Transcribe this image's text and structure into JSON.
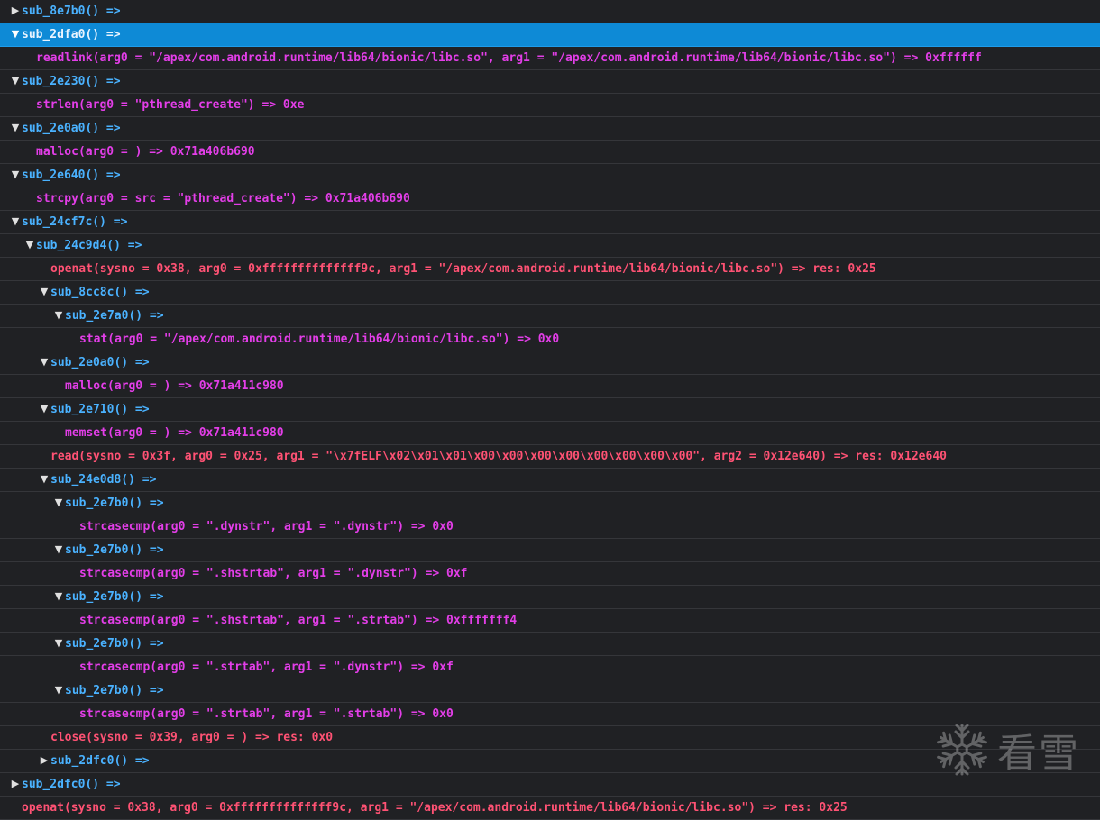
{
  "colors": {
    "background": "#202124",
    "selected_row": "#0e8ad6",
    "function_name": "#4ab2ff",
    "libc_call": "#e33ee8",
    "syscall": "#ff5274"
  },
  "rows": [
    {
      "depth": 0,
      "kind": "node",
      "expanded": false,
      "text": "sub_8e7b0() =>"
    },
    {
      "depth": 0,
      "kind": "node",
      "expanded": true,
      "selected": true,
      "text": "sub_2dfa0() =>"
    },
    {
      "depth": 1,
      "kind": "libc",
      "text": "readlink(arg0 = \"/apex/com.android.runtime/lib64/bionic/libc.so\", arg1 = \"/apex/com.android.runtime/lib64/bionic/libc.so\") => 0xffffff"
    },
    {
      "depth": 0,
      "kind": "node",
      "expanded": true,
      "text": "sub_2e230() =>"
    },
    {
      "depth": 1,
      "kind": "libc",
      "text": "strlen(arg0 = \"pthread_create\") => 0xe"
    },
    {
      "depth": 0,
      "kind": "node",
      "expanded": true,
      "text": "sub_2e0a0() =>"
    },
    {
      "depth": 1,
      "kind": "libc",
      "text": "malloc(arg0 = ) => 0x71a406b690"
    },
    {
      "depth": 0,
      "kind": "node",
      "expanded": true,
      "text": "sub_2e640() =>"
    },
    {
      "depth": 1,
      "kind": "libc",
      "text": "strcpy(arg0 = src = \"pthread_create\") => 0x71a406b690"
    },
    {
      "depth": 0,
      "kind": "node",
      "expanded": true,
      "text": "sub_24cf7c() =>"
    },
    {
      "depth": 1,
      "kind": "node",
      "expanded": true,
      "text": "sub_24c9d4() =>"
    },
    {
      "depth": 2,
      "kind": "sys",
      "text": "openat(sysno = 0x38, arg0 = 0xffffffffffffff9c, arg1 = \"/apex/com.android.runtime/lib64/bionic/libc.so\") => res: 0x25"
    },
    {
      "depth": 2,
      "kind": "node",
      "expanded": true,
      "text": "sub_8cc8c() =>"
    },
    {
      "depth": 3,
      "kind": "node",
      "expanded": true,
      "text": "sub_2e7a0() =>"
    },
    {
      "depth": 4,
      "kind": "libc",
      "text": "stat(arg0 = \"/apex/com.android.runtime/lib64/bionic/libc.so\") => 0x0"
    },
    {
      "depth": 2,
      "kind": "node",
      "expanded": true,
      "text": "sub_2e0a0() =>"
    },
    {
      "depth": 3,
      "kind": "libc",
      "text": "malloc(arg0 = ) => 0x71a411c980"
    },
    {
      "depth": 2,
      "kind": "node",
      "expanded": true,
      "text": "sub_2e710() =>"
    },
    {
      "depth": 3,
      "kind": "libc",
      "text": "memset(arg0 = ) => 0x71a411c980"
    },
    {
      "depth": 2,
      "kind": "sys",
      "text": "read(sysno = 0x3f, arg0 = 0x25, arg1 = \"\\x7fELF\\x02\\x01\\x01\\x00\\x00\\x00\\x00\\x00\\x00\\x00\\x00\", arg2 = 0x12e640) => res: 0x12e640"
    },
    {
      "depth": 2,
      "kind": "node",
      "expanded": true,
      "text": "sub_24e0d8() =>"
    },
    {
      "depth": 3,
      "kind": "node",
      "expanded": true,
      "text": "sub_2e7b0() =>"
    },
    {
      "depth": 4,
      "kind": "libc",
      "text": "strcasecmp(arg0 = \".dynstr\", arg1 = \".dynstr\") => 0x0"
    },
    {
      "depth": 3,
      "kind": "node",
      "expanded": true,
      "text": "sub_2e7b0() =>"
    },
    {
      "depth": 4,
      "kind": "libc",
      "text": "strcasecmp(arg0 = \".shstrtab\", arg1 = \".dynstr\") => 0xf"
    },
    {
      "depth": 3,
      "kind": "node",
      "expanded": true,
      "text": "sub_2e7b0() =>"
    },
    {
      "depth": 4,
      "kind": "libc",
      "text": "strcasecmp(arg0 = \".shstrtab\", arg1 = \".strtab\") => 0xfffffff4"
    },
    {
      "depth": 3,
      "kind": "node",
      "expanded": true,
      "text": "sub_2e7b0() =>"
    },
    {
      "depth": 4,
      "kind": "libc",
      "text": "strcasecmp(arg0 = \".strtab\", arg1 = \".dynstr\") => 0xf"
    },
    {
      "depth": 3,
      "kind": "node",
      "expanded": true,
      "text": "sub_2e7b0() =>"
    },
    {
      "depth": 4,
      "kind": "libc",
      "text": "strcasecmp(arg0 = \".strtab\", arg1 = \".strtab\") => 0x0"
    },
    {
      "depth": 2,
      "kind": "sys",
      "text": "close(sysno = 0x39, arg0 = ) => res: 0x0"
    },
    {
      "depth": 2,
      "kind": "node",
      "expanded": false,
      "text": "sub_2dfc0() =>"
    },
    {
      "depth": 0,
      "kind": "node",
      "expanded": false,
      "text": "sub_2dfc0() =>"
    },
    {
      "depth": 0,
      "kind": "sys",
      "text": "openat(sysno = 0x38, arg0 = 0xffffffffffffff9c, arg1 = \"/apex/com.android.runtime/lib64/bionic/libc.so\") => res: 0x25"
    }
  ],
  "watermark": {
    "icon": "snowflake-icon",
    "text": "看雪"
  }
}
